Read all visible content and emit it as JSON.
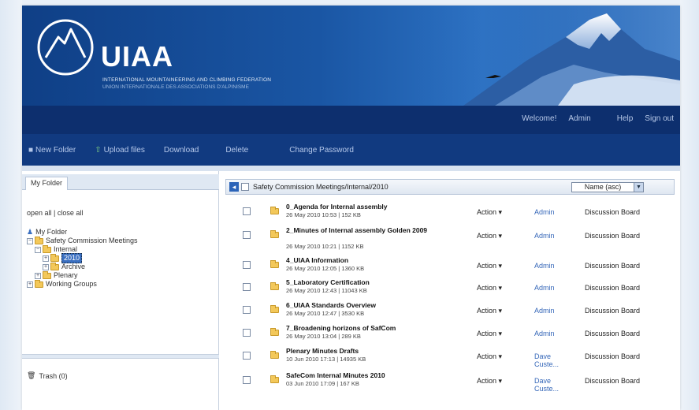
{
  "header": {
    "brand": "UIAA",
    "subtitle_en": "INTERNATIONAL MOUNTAINEERING AND CLIMBING FEDERATION",
    "subtitle_fr": "UNION INTERNATIONALE DES ASSOCIATIONS D'ALPINISME"
  },
  "toplinks": [
    "Welcome!",
    "Admin",
    "Help",
    "Sign out"
  ],
  "toolbar": {
    "new_folder": "New Folder",
    "upload_files": "Upload files",
    "download": "Download",
    "delete": "Delete",
    "change_password": "Change Password"
  },
  "sidebar": {
    "tab": "My Folder",
    "open_close": "open all | close all",
    "tree": {
      "root": "My Folder",
      "safety": "Safety Commission Meetings",
      "internal": "Internal",
      "year": "2010",
      "archive": "Archive",
      "plenary": "Plenary",
      "working": "Working Groups"
    },
    "trash": "Trash (0)"
  },
  "main": {
    "path": "Safety Commission Meetings/Internal/2010",
    "sort": "Name (asc)",
    "rows": [
      {
        "name": "0_Agenda for Internal assembly",
        "meta": "26 May 2010 10:53 | 152 KB",
        "action": "Action ▾",
        "owner": "Admin",
        "board": "Discussion Board"
      },
      {
        "name": "2_Minutes of Internal assembly Golden 2009",
        "meta": "26 May 2010 10:21 | 1152 KB",
        "action": "Action ▾",
        "owner": "Admin",
        "board": "Discussion Board"
      },
      {
        "name": "4_UIAA Information",
        "meta": "26 May 2010 12:05 | 1360 KB",
        "action": "Action ▾",
        "owner": "Admin",
        "board": "Discussion Board"
      },
      {
        "name": "5_Laboratory Certification",
        "meta": "26 May 2010 12:43 | 11043 KB",
        "action": "Action ▾",
        "owner": "Admin",
        "board": "Discussion Board"
      },
      {
        "name": "6_UIAA Standards Overview",
        "meta": "26 May 2010 12:47 | 3530 KB",
        "action": "Action ▾",
        "owner": "Admin",
        "board": "Discussion Board"
      },
      {
        "name": "7_Broadening horizons of SafCom",
        "meta": "26 May 2010 13:04 | 289 KB",
        "action": "Action ▾",
        "owner": "Admin",
        "board": "Discussion Board"
      },
      {
        "name": "Plenary Minutes Drafts",
        "meta": "10 Jun 2010 17:13 | 14935 KB",
        "action": "Action ▾",
        "owner": "Dave Custe...",
        "board": "Discussion Board"
      },
      {
        "name": "SafeCom Internal Minutes 2010",
        "meta": "03 Jun 2010 17:09 | 167 KB",
        "action": "Action ▾",
        "owner": "Dave Custe...",
        "board": "Discussion Board"
      }
    ]
  }
}
